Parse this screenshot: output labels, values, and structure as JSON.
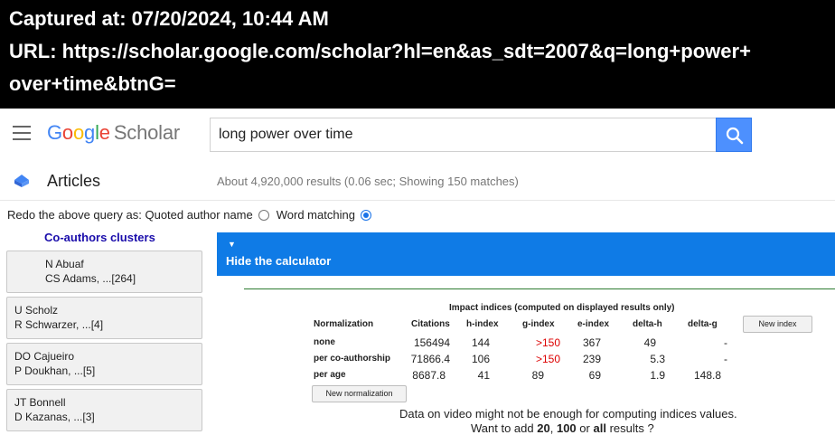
{
  "capture": {
    "line1": "Captured at: 07/20/2024, 10:44 AM",
    "line2": "URL: https://scholar.google.com/scholar?hl=en&as_sdt=2007&q=long+power+",
    "line3": "over+time&btnG="
  },
  "header": {
    "logo_google": [
      "G",
      "o",
      "o",
      "g",
      "l",
      "e"
    ],
    "logo_scholar": "Scholar",
    "search_value": "long power over time"
  },
  "subbar": {
    "section": "Articles",
    "stats": "About 4,920,000 results (0.06 sec; Showing 150 matches)"
  },
  "redo": {
    "prefix": "Redo the above query as: Quoted author name",
    "option2": "Word matching",
    "selected": "Word matching"
  },
  "clusters": {
    "heading": "Co-authors clusters",
    "items": [
      {
        "line1": "N Abuaf",
        "line2": "CS Adams, ...[264]"
      },
      {
        "line1": "U Scholz",
        "line2": "R Schwarzer, ...[4]"
      },
      {
        "line1": "DO Cajueiro",
        "line2": "P Doukhan, ...[5]"
      },
      {
        "line1": "JT Bonnell",
        "line2": "D Kazanas, ...[3]"
      }
    ]
  },
  "calculator": {
    "toggle_label": "Hide the calculator",
    "caption": "Impact indices (computed on displayed results only)",
    "columns": [
      "Normalization",
      "Citations",
      "h-index",
      "g-index",
      "e-index",
      "delta-h",
      "delta-g"
    ],
    "rows": [
      {
        "label": "none",
        "citations": "156494",
        "h": "144",
        "g": ">150",
        "e": "367",
        "dh": "49",
        "dg": "-"
      },
      {
        "label": "per co-authorship",
        "citations": "71866.4",
        "h": "106",
        "g": ">150",
        "e": "239",
        "dh": "5.3",
        "dg": "-"
      },
      {
        "label": "per age",
        "citations": "8687.8",
        "h": "41",
        "g": "89",
        "e": "69",
        "dh": "1.9",
        "dg": "148.8"
      }
    ],
    "new_index_button": "New index",
    "new_normalization_button": "New normalization",
    "note_line1": "Data on video might not be enough for computing indices values.",
    "note_prefix": "Want to add",
    "note_20": "20",
    "note_comma": ",",
    "note_100": "100",
    "note_or": "or",
    "note_all": "all",
    "note_suffix": "results ?"
  },
  "colors": {
    "accent_blue": "#0f7be6",
    "search_button": "#4d90fe",
    "link": "#1a0dab",
    "highlight_red": "#dd0000"
  }
}
